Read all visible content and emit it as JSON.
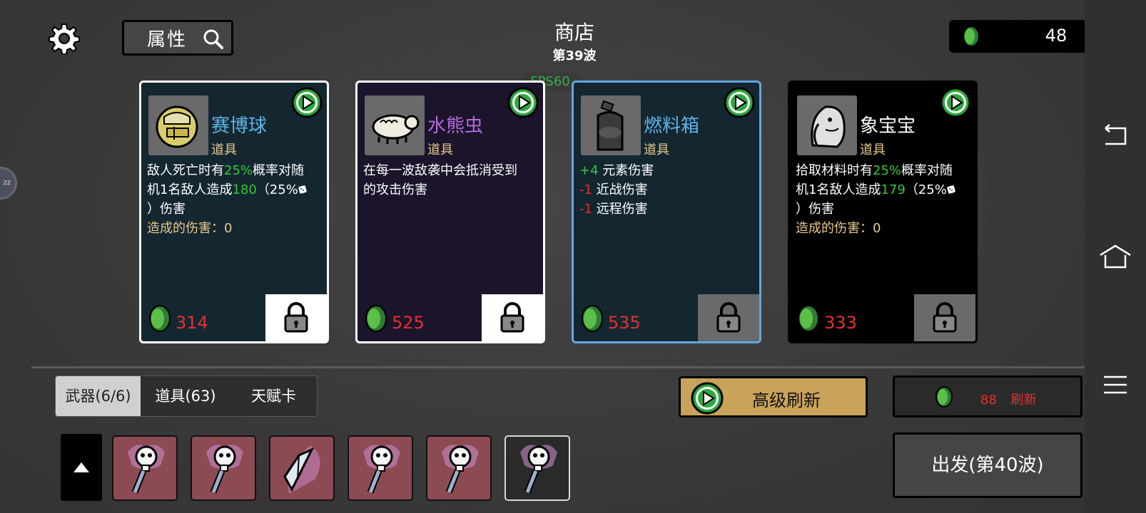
{
  "header": {
    "title": "商店",
    "wave": "第39波",
    "fps": "FPS60",
    "attributes_label": "属性",
    "money": "48"
  },
  "cards": [
    {
      "name": "赛博球",
      "name_color": "#5db3e8",
      "type": "道具",
      "desc_lines": [
        [
          "敌人死亡时有",
          "25%",
          "概率对随"
        ],
        [
          "机1名敌人造成",
          "180",
          "（25%"
        ],
        [
          "）伤害"
        ]
      ],
      "extra": "造成的伤害：0",
      "price": "314",
      "bg": "#142731",
      "border": "#ffffff",
      "locked": false,
      "icon": "cyber-ball-icon"
    },
    {
      "name": "水熊虫",
      "name_color": "#b46be0",
      "type": "道具",
      "desc_lines": [
        [
          "在每一波敌袭中会抵消受到"
        ],
        [
          "的攻击伤害"
        ]
      ],
      "extra": "",
      "price": "525",
      "bg": "#1b142a",
      "border": "#ffffff",
      "locked": false,
      "icon": "tardigrade-icon"
    },
    {
      "name": "燃料箱",
      "name_color": "#5db3e8",
      "type": "道具",
      "stats": [
        {
          "value": "+4",
          "color": "#36c836",
          "label": "元素伤害"
        },
        {
          "value": "-1",
          "color": "#e53030",
          "label": "近战伤害"
        },
        {
          "value": "-1",
          "color": "#e53030",
          "label": "远程伤害"
        }
      ],
      "price": "535",
      "bg": "#142731",
      "border": "#5fa8e0",
      "locked": true,
      "icon": "fuel-tank-icon"
    },
    {
      "name": "象宝宝",
      "name_color": "#ffffff",
      "type": "道具",
      "desc_lines": [
        [
          "拾取材料时有",
          "25%",
          "概率对随"
        ],
        [
          "机1名敌人造成",
          "179",
          "（25%"
        ],
        [
          "）伤害"
        ]
      ],
      "extra": "造成的伤害：0",
      "price": "333",
      "bg": "#000000",
      "border": "#000000",
      "locked": true,
      "icon": "baby-elephant-icon"
    }
  ],
  "tabs": [
    {
      "label": "武器(6/6)",
      "active": true
    },
    {
      "label": "道具(63)",
      "active": false
    },
    {
      "label": "天赋卡",
      "active": false
    }
  ],
  "buttons": {
    "advanced_refresh": "高级刷新",
    "refresh_cost": "88",
    "refresh_label": "刷新",
    "go": "出发(第40波)"
  },
  "weapons": [
    {
      "icon": "skull-staff-icon",
      "selected": false
    },
    {
      "icon": "skull-staff-icon",
      "selected": false
    },
    {
      "icon": "crystal-shard-icon",
      "selected": false
    },
    {
      "icon": "skull-staff-icon",
      "selected": false
    },
    {
      "icon": "skull-staff-icon",
      "selected": false
    },
    {
      "icon": "skull-staff-icon",
      "selected": true
    }
  ],
  "colors": {
    "price": "#e53030",
    "highlight_green": "#36c836",
    "advanced_refresh_bg": "#c9a35a"
  }
}
